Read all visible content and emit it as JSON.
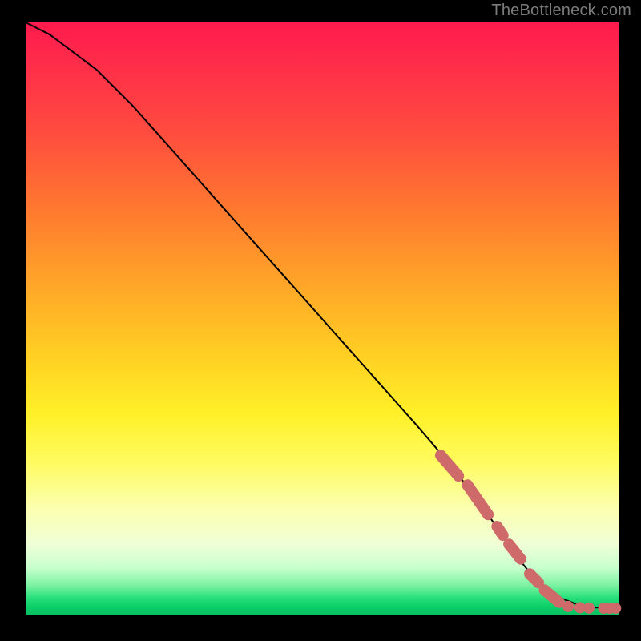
{
  "attribution": "TheBottleneck.com",
  "colors": {
    "dot": "#cf6a6a",
    "curve": "#000000"
  },
  "chart_data": {
    "type": "line",
    "title": "",
    "xlabel": "",
    "ylabel": "",
    "xlim": [
      0,
      100
    ],
    "ylim": [
      0,
      100
    ],
    "grid": false,
    "legend": null,
    "series": [
      {
        "name": "curve",
        "style": "solid",
        "color": "#000000",
        "x": [
          0,
          4,
          8,
          12,
          18,
          26,
          34,
          42,
          50,
          58,
          66,
          72,
          78,
          82,
          86,
          90,
          94,
          98,
          100
        ],
        "y": [
          100,
          98,
          95,
          92,
          86,
          77,
          68,
          59,
          50,
          41,
          32,
          25,
          17,
          11,
          6,
          3,
          1.5,
          1.2,
          1.2
        ]
      },
      {
        "name": "highlight-marks",
        "style": "thick-dots",
        "color": "#cf6a6a",
        "segments": [
          {
            "x": [
              70,
              73
            ],
            "y": [
              27,
              23.5
            ]
          },
          {
            "x": [
              74.5,
              78
            ],
            "y": [
              22,
              17
            ]
          },
          {
            "x": [
              79.5,
              80.5
            ],
            "y": [
              15,
              13.5
            ]
          },
          {
            "x": [
              81.5,
              83.5
            ],
            "y": [
              12,
              9.5
            ]
          },
          {
            "x": [
              85,
              86.5
            ],
            "y": [
              7,
              5.5
            ]
          },
          {
            "x": [
              87.5,
              90
            ],
            "y": [
              4.3,
              2.2
            ]
          }
        ],
        "dots": [
          {
            "x": 91.5,
            "y": 1.5
          },
          {
            "x": 93.5,
            "y": 1.3
          },
          {
            "x": 95.0,
            "y": 1.25
          },
          {
            "x": 97.5,
            "y": 1.2
          },
          {
            "x": 98.5,
            "y": 1.2
          },
          {
            "x": 99.5,
            "y": 1.2
          }
        ],
        "dot_radius": 7
      }
    ]
  }
}
